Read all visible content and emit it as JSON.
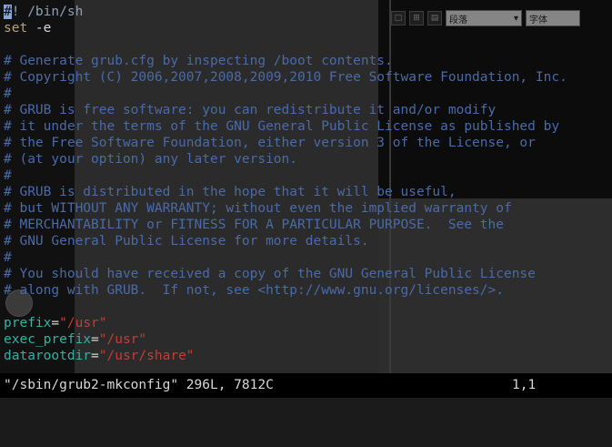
{
  "background_app": {
    "toolbar": {
      "style_select": "段落",
      "font_select": "字体"
    }
  },
  "editor": {
    "lines": [
      {
        "type": "shebang",
        "cursor_char": "#",
        "rest": "! /bin/sh"
      },
      {
        "type": "keyword",
        "keyword": "set",
        "rest": " -e"
      },
      {
        "type": "blank"
      },
      {
        "type": "comment",
        "text": "# Generate grub.cfg by inspecting /boot contents."
      },
      {
        "type": "comment",
        "text": "# Copyright (C) 2006,2007,2008,2009,2010 Free Software Foundation, Inc."
      },
      {
        "type": "comment",
        "text": "#"
      },
      {
        "type": "comment",
        "text": "# GRUB is free software: you can redistribute it and/or modify"
      },
      {
        "type": "comment",
        "text": "# it under the terms of the GNU General Public License as published by"
      },
      {
        "type": "comment",
        "text": "# the Free Software Foundation, either version 3 of the License, or"
      },
      {
        "type": "comment",
        "text": "# (at your option) any later version."
      },
      {
        "type": "comment",
        "text": "#"
      },
      {
        "type": "comment",
        "text": "# GRUB is distributed in the hope that it will be useful,"
      },
      {
        "type": "comment",
        "text": "# but WITHOUT ANY WARRANTY; without even the implied warranty of"
      },
      {
        "type": "comment",
        "text": "# MERCHANTABILITY or FITNESS FOR A PARTICULAR PURPOSE.  See the"
      },
      {
        "type": "comment",
        "text": "# GNU General Public License for more details."
      },
      {
        "type": "comment",
        "text": "#"
      },
      {
        "type": "comment",
        "text": "# You should have received a copy of the GNU General Public License"
      },
      {
        "type": "comment",
        "text": "# along with GRUB.  If not, see <http://www.gnu.org/licenses/>."
      },
      {
        "type": "blank"
      },
      {
        "type": "assign",
        "name": "prefix",
        "value": "\"/usr\""
      },
      {
        "type": "assign",
        "name": "exec_prefix",
        "value": "\"/usr\""
      },
      {
        "type": "assign",
        "name": "datarootdir",
        "value": "\"/usr/share\""
      }
    ]
  },
  "status_bar": {
    "file_info": "\"/sbin/grub2-mkconfig\" 296L, 7812C",
    "cursor_position": "1,1"
  },
  "colors": {
    "comment": "#4a6aa8",
    "keyword": "#b8a27e",
    "variable": "#32b2a2",
    "string": "#c23e36",
    "status_bar_bg": "#000000"
  }
}
